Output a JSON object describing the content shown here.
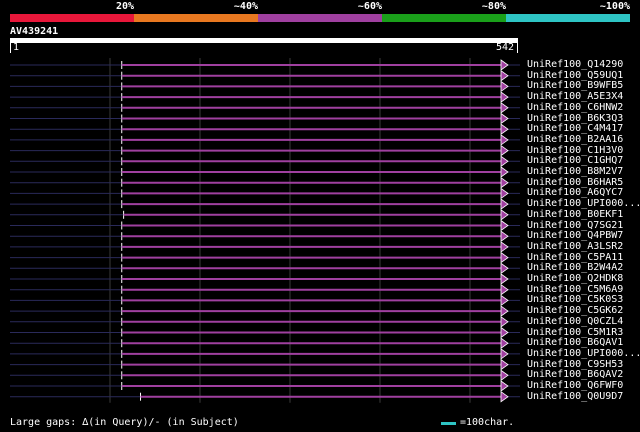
{
  "colors": {
    "background": "#000000",
    "hit_line": "#a040a0",
    "gap_line": "#2a2a5a",
    "guide": "#3a3a3a",
    "scale_accent": "#2ec4c4"
  },
  "legend": {
    "segments": [
      {
        "label": "20%",
        "color": "#e8173a"
      },
      {
        "label": "~40%",
        "color": "#e87820"
      },
      {
        "label": "~60%",
        "color": "#a040a0"
      },
      {
        "label": "~80%",
        "color": "#1aa01a"
      },
      {
        "label": "~100%",
        "color": "#2ec4c4"
      }
    ]
  },
  "query": {
    "id": "AV439241",
    "start_label": "1",
    "end_label": "542",
    "length": 542
  },
  "hits": [
    {
      "name": "UniRef100_Q14290",
      "start": 120,
      "end": 545
    },
    {
      "name": "UniRef100_Q59UQ1",
      "start": 120,
      "end": 580
    },
    {
      "name": "UniRef100_B9WFB5",
      "start": 120,
      "end": 580
    },
    {
      "name": "UniRef100_A5E3X4",
      "start": 120,
      "end": 580
    },
    {
      "name": "UniRef100_C6HNW2",
      "start": 120,
      "end": 555
    },
    {
      "name": "UniRef100_B6K3Q3",
      "start": 120,
      "end": 545
    },
    {
      "name": "UniRef100_C4M417",
      "start": 120,
      "end": 548
    },
    {
      "name": "UniRef100_B2AA16",
      "start": 120,
      "end": 545
    },
    {
      "name": "UniRef100_C1H3V0",
      "start": 120,
      "end": 545
    },
    {
      "name": "UniRef100_C1GHQ7",
      "start": 120,
      "end": 545
    },
    {
      "name": "UniRef100_B8M2V7",
      "start": 120,
      "end": 545
    },
    {
      "name": "UniRef100_B6HAR5",
      "start": 120,
      "end": 590
    },
    {
      "name": "UniRef100_A6QYC7",
      "start": 120,
      "end": 560
    },
    {
      "name": "UniRef100_UPI000...",
      "start": 120,
      "end": 545
    },
    {
      "name": "UniRef100_B0EKF1",
      "start": 122,
      "end": 548
    },
    {
      "name": "UniRef100_Q7SG21",
      "start": 120,
      "end": 545
    },
    {
      "name": "UniRef100_Q4PBW7",
      "start": 120,
      "end": 590
    },
    {
      "name": "UniRef100_A3LSR2",
      "start": 120,
      "end": 565
    },
    {
      "name": "UniRef100_C5PA11",
      "start": 120,
      "end": 560
    },
    {
      "name": "UniRef100_B2W4A2",
      "start": 120,
      "end": 550
    },
    {
      "name": "UniRef100_Q2HDK8",
      "start": 120,
      "end": 590
    },
    {
      "name": "UniRef100_C5M6A9",
      "start": 120,
      "end": 590
    },
    {
      "name": "UniRef100_C5K0S3",
      "start": 120,
      "end": 560
    },
    {
      "name": "UniRef100_C5GK62",
      "start": 120,
      "end": 560
    },
    {
      "name": "UniRef100_Q0CZL4",
      "start": 120,
      "end": 560
    },
    {
      "name": "UniRef100_C5M1R3",
      "start": 120,
      "end": 590
    },
    {
      "name": "UniRef100_B6QAV1",
      "start": 120,
      "end": 555
    },
    {
      "name": "UniRef100_UPI000...",
      "start": 120,
      "end": 575
    },
    {
      "name": "UniRef100_C9SH53",
      "start": 120,
      "end": 545
    },
    {
      "name": "UniRef100_B6QAV2",
      "start": 120,
      "end": 545
    },
    {
      "name": "UniRef100_Q6FWF0",
      "start": 120,
      "end": 545
    },
    {
      "name": "UniRef100_Q0U9D7",
      "start": 140,
      "end": 565
    }
  ],
  "footer": {
    "large_gaps": "Large gaps: ∆(in Query)/- (in Subject)",
    "scale": "=100char."
  }
}
